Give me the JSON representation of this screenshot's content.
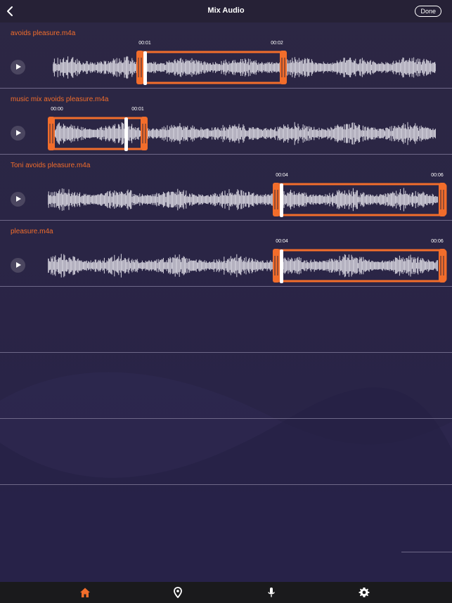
{
  "header": {
    "title": "Mix Audio",
    "done_label": "Done",
    "back_icon": "chevron-left-icon"
  },
  "accent": "#f26d2b",
  "tracks": [
    {
      "name": "avoids pleasure.m4a",
      "start_time": "00:01",
      "end_time": "00:02"
    },
    {
      "name": "music mix avoids pleasure.m4a",
      "start_time": "00:00",
      "end_time": "00:01"
    },
    {
      "name": "Toni avoids pleasure.m4a",
      "start_time": "00:04",
      "end_time": "00:06"
    },
    {
      "name": "pleasure.m4a",
      "start_time": "00:04",
      "end_time": "00:06"
    }
  ],
  "tabs": [
    {
      "icon": "home-icon",
      "active": true
    },
    {
      "icon": "location-pin-icon",
      "active": false
    },
    {
      "icon": "microphone-icon",
      "active": false
    },
    {
      "icon": "gear-icon",
      "active": false
    }
  ]
}
